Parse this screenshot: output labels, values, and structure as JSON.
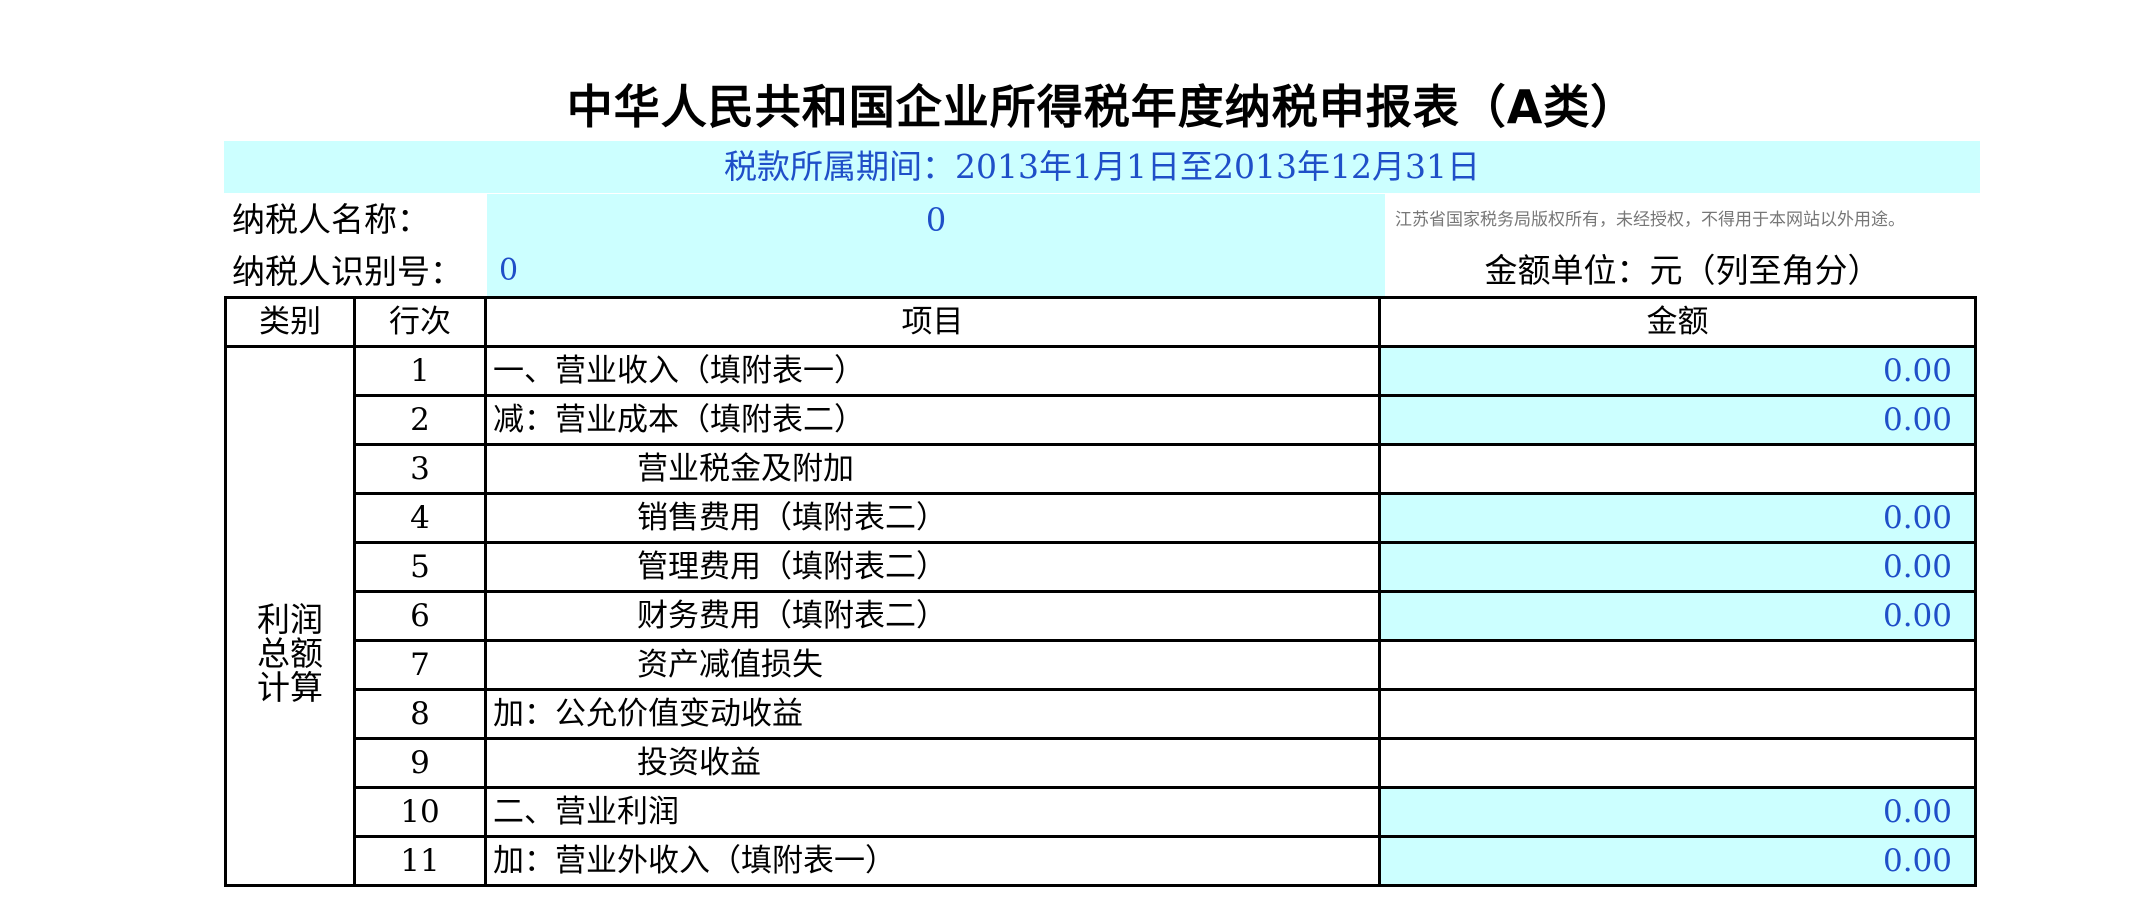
{
  "title": "中华人民共和国企业所得税年度纳税申报表（A类）",
  "period": "税款所属期间：2013年1月1日至2013年12月31日",
  "taxpayer": {
    "name_label": "纳税人名称：",
    "name_value": "0",
    "id_label": "纳税人识别号：",
    "id_value": "0"
  },
  "copyright": "江苏省国家税务局版权所有，未经授权，不得用于本网站以外用途。",
  "unit": "金额单位：元（列至角分）",
  "table": {
    "headers": [
      "类别",
      "行次",
      "项目",
      "金额"
    ],
    "category_lines": [
      "利润",
      "总额",
      "计算"
    ],
    "rows": [
      {
        "no": "1",
        "item": "一、营业收入（填附表一）",
        "amount": "0.00",
        "indent": false
      },
      {
        "no": "2",
        "item": "减：营业成本（填附表二）",
        "amount": "0.00",
        "indent": false
      },
      {
        "no": "3",
        "item": "营业税金及附加",
        "amount": "",
        "indent": true
      },
      {
        "no": "4",
        "item": "销售费用（填附表二）",
        "amount": "0.00",
        "indent": true
      },
      {
        "no": "5",
        "item": "管理费用（填附表二）",
        "amount": "0.00",
        "indent": true
      },
      {
        "no": "6",
        "item": "财务费用（填附表二）",
        "amount": "0.00",
        "indent": true
      },
      {
        "no": "7",
        "item": "资产减值损失",
        "amount": "",
        "indent": true
      },
      {
        "no": "8",
        "item": "加：公允价值变动收益",
        "amount": "",
        "indent": false
      },
      {
        "no": "9",
        "item": "投资收益",
        "amount": "",
        "indent": true
      },
      {
        "no": "10",
        "item": "二、营业利润",
        "amount": "0.00",
        "indent": false
      },
      {
        "no": "11",
        "item": "加：营业外收入（填附表一）",
        "amount": "0.00",
        "indent": false
      }
    ]
  },
  "colors": {
    "input_fill": "#ccffff",
    "value_text": "#1f4fc8",
    "border": "#000000"
  }
}
